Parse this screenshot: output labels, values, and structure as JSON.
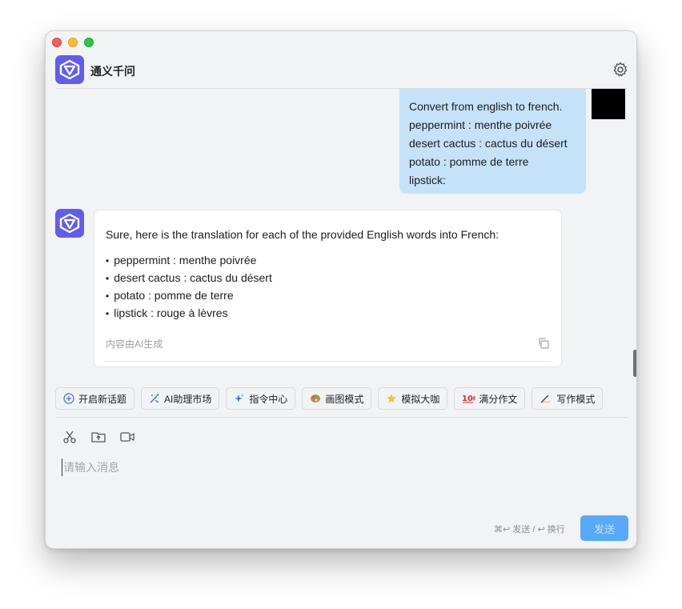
{
  "app": {
    "title": "通义千问"
  },
  "user_message": {
    "lines": [
      "Convert from english to french.",
      "peppermint : menthe poivrée",
      "desert cactus : cactus du désert",
      "potato : pomme de terre",
      "lipstick:"
    ]
  },
  "bot_message": {
    "intro": "Sure, here is the translation for each of the provided English words into French:",
    "items": [
      "peppermint : menthe poivrée",
      "desert cactus : cactus du désert",
      "potato : pomme de terre",
      "lipstick : rouge à lèvres"
    ],
    "ai_note": "内容由AI生成"
  },
  "chips": [
    {
      "label": "开启新话题",
      "icon": "plus-circle-icon"
    },
    {
      "label": "AI助理市场",
      "icon": "magic-wand-icon"
    },
    {
      "label": "指令中心",
      "icon": "sparkle-icon"
    },
    {
      "label": "画图模式",
      "icon": "palette-icon"
    },
    {
      "label": "模拟大咖",
      "icon": "star-icon"
    },
    {
      "label": "满分作文",
      "icon": "hundred-icon"
    },
    {
      "label": "写作模式",
      "icon": "writing-hand-icon"
    }
  ],
  "composer": {
    "placeholder": "请输入消息",
    "hint": "⌘↩ 发送 / ↩ 换行",
    "send_label": "发送"
  },
  "colors": {
    "brand": "#615ced",
    "user_bubble": "#c5e2f9",
    "send_button": "#58a9f9"
  }
}
